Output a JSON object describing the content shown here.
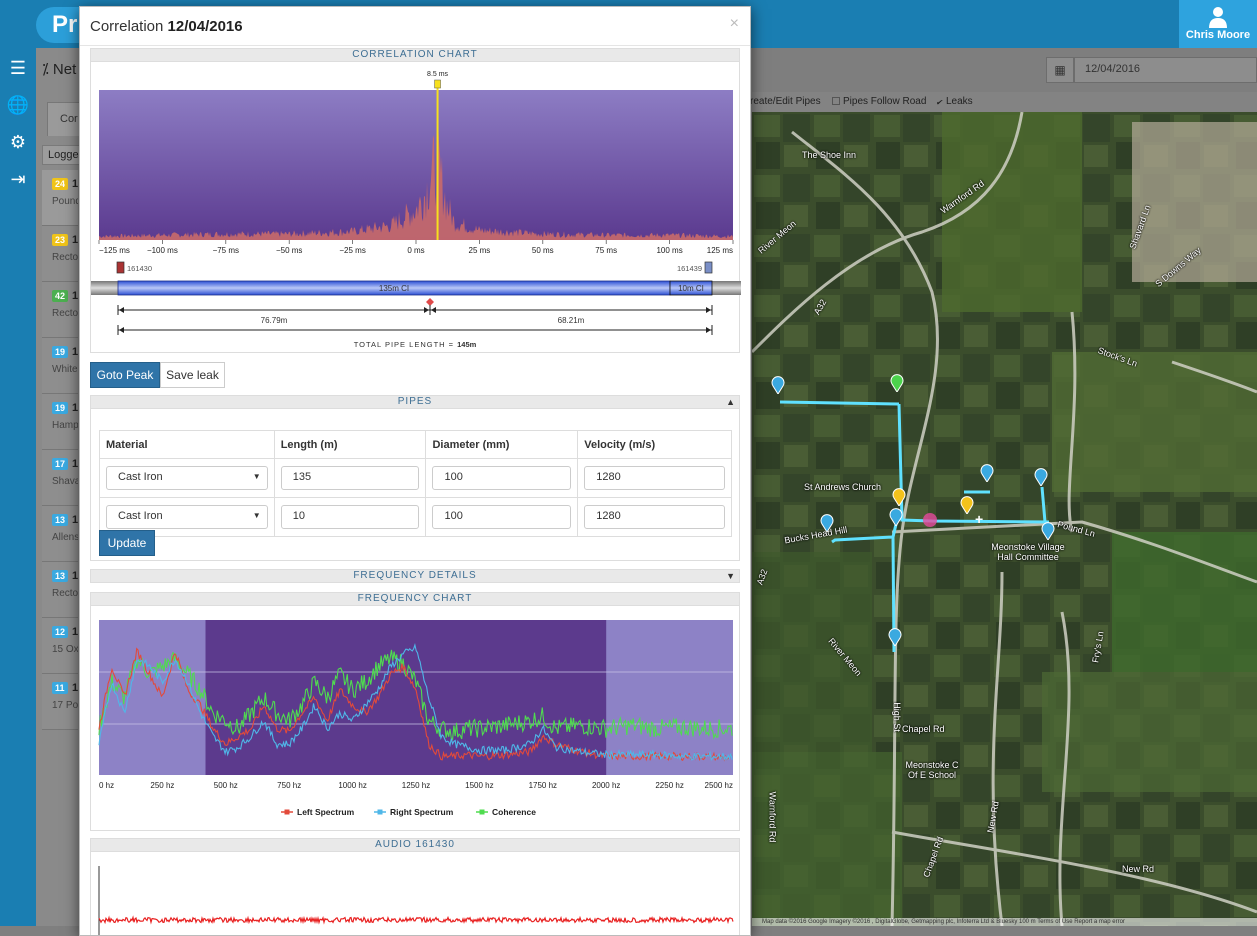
{
  "app": {
    "brand": "Pr",
    "user_name": "Chris Moore",
    "page_title": "Net",
    "tab_label": "Cor",
    "filter_label": "Logge",
    "date_value": "12/04/2016",
    "options": [
      {
        "label": "reate/Edit Pipes",
        "checked": null
      },
      {
        "label": "Pipes Follow Road",
        "checked": false
      },
      {
        "label": "Leaks",
        "checked": true
      }
    ],
    "loggers": [
      {
        "badge": "24",
        "color": "#f0c419",
        "id": "1",
        "addr": "Pound"
      },
      {
        "badge": "23",
        "color": "#f0c419",
        "id": "1",
        "addr": "Rector"
      },
      {
        "badge": "42",
        "color": "#4caf50",
        "id": "1",
        "addr": "Rector"
      },
      {
        "badge": "19",
        "color": "#3aa9e0",
        "id": "1",
        "addr": "White"
      },
      {
        "badge": "19",
        "color": "#3aa9e0",
        "id": "1",
        "addr": "Hamp"
      },
      {
        "badge": "17",
        "color": "#3aa9e0",
        "id": "1",
        "addr": "Shava"
      },
      {
        "badge": "13",
        "color": "#3aa9e0",
        "id": "1",
        "addr": "Allens"
      },
      {
        "badge": "13",
        "color": "#3aa9e0",
        "id": "1",
        "addr": "Rector"
      },
      {
        "badge": "12",
        "color": "#3aa9e0",
        "id": "1",
        "addr": "15 Ox"
      },
      {
        "badge": "11",
        "color": "#3aa9e0",
        "id": "1",
        "addr": "17 Po"
      }
    ],
    "map_labels": [
      "The Shoe Inn",
      "Warnford Rd",
      "River Meon",
      "A32",
      "Shavard Ln",
      "S Downs Way",
      "Stock's Ln",
      "St Andrews Church",
      "Pound Ln",
      "Meonstoke Village Hall Committee",
      "Bucks Head Hill",
      "River Meon",
      "Fry's Ln",
      "High St",
      "Chapel Rd",
      "Meonstoke C Of E School",
      "Chapel Rd",
      "New Rd",
      "New Rd",
      "Warnford Rd",
      "A32"
    ],
    "map_footer": "Map data ©2016 Google Imagery ©2016 , DigitalGlobe, Getmapping plc, Infoterra Ltd & Bluesky   100 m   Terms of Use   Report a map error"
  },
  "modal": {
    "title_prefix": "Correlation ",
    "title_date": "12/04/2016",
    "close": "×"
  },
  "correlation": {
    "section_title": "CORRELATION CHART",
    "peak_label": "8.5 ms",
    "x_ticks": [
      "−125 ms",
      "−100 ms",
      "−75 ms",
      "−50 ms",
      "−25 ms",
      "0 ms",
      "25 ms",
      "50 ms",
      "75 ms",
      "100 ms",
      "125 ms"
    ],
    "left_logger": "161430",
    "right_logger": "161439",
    "pipe_segment_1": "135m CI",
    "pipe_segment_2": "10m CI",
    "dist_left": "76.79m",
    "dist_right": "68.21m",
    "total_label": "TOTAL PIPE LENGTH = ",
    "total_value": "145m"
  },
  "chart_data": [
    {
      "type": "area",
      "title": "CORRELATION CHART",
      "x_unit": "ms",
      "xlim": [
        -125,
        125
      ],
      "x_ticks": [
        -125,
        -100,
        -75,
        -50,
        -25,
        0,
        25,
        50,
        75,
        100,
        125
      ],
      "peak_x": 8.5,
      "series": [
        {
          "color": "#c96a6a",
          "x": [
            -125,
            -100,
            -75,
            -50,
            -25,
            -10,
            0,
            4,
            6,
            8.5,
            10,
            12,
            15,
            25,
            50,
            75,
            100,
            125
          ],
          "values": [
            0.03,
            0.04,
            0.05,
            0.05,
            0.07,
            0.12,
            0.25,
            0.4,
            0.55,
            0.65,
            0.5,
            0.3,
            0.15,
            0.08,
            0.05,
            0.04,
            0.04,
            0.03
          ]
        }
      ]
    },
    {
      "type": "line",
      "title": "FREQUENCY CHART",
      "x_unit": "hz",
      "xlim": [
        0,
        2500
      ],
      "x_ticks": [
        0,
        250,
        500,
        750,
        1000,
        1250,
        1500,
        1750,
        2000,
        2250,
        2500
      ],
      "highlight_range": [
        420,
        2000
      ],
      "series": [
        {
          "name": "Left Spectrum",
          "color": "#e24a3b",
          "x": [
            0,
            50,
            100,
            150,
            200,
            250,
            300,
            350,
            400,
            450,
            500,
            550,
            600,
            650,
            700,
            750,
            800,
            850,
            900,
            950,
            1000,
            1050,
            1100,
            1150,
            1200,
            1250,
            1300,
            1350,
            1400,
            1450,
            1500,
            1600,
            1700,
            1750,
            1800,
            1900,
            2000,
            2100,
            2200,
            2300,
            2400,
            2500
          ],
          "values": [
            0.3,
            0.7,
            0.5,
            0.8,
            0.65,
            0.5,
            0.8,
            0.55,
            0.45,
            0.3,
            0.2,
            0.25,
            0.3,
            0.45,
            0.3,
            0.28,
            0.4,
            0.5,
            0.35,
            0.55,
            0.45,
            0.4,
            0.5,
            0.65,
            0.7,
            0.55,
            0.2,
            0.12,
            0.12,
            0.13,
            0.12,
            0.13,
            0.15,
            0.25,
            0.2,
            0.15,
            0.12,
            0.12,
            0.12,
            0.12,
            0.12,
            0.11
          ]
        },
        {
          "name": "Right Spectrum",
          "color": "#4fb7e8",
          "x": [
            0,
            50,
            100,
            150,
            200,
            250,
            300,
            350,
            400,
            450,
            500,
            550,
            600,
            650,
            700,
            750,
            800,
            850,
            900,
            950,
            1000,
            1050,
            1100,
            1150,
            1200,
            1250,
            1300,
            1350,
            1400,
            1450,
            1500,
            1600,
            1700,
            1750,
            1800,
            1900,
            2000,
            2100,
            2200,
            2300,
            2400,
            2500
          ],
          "values": [
            0.2,
            0.6,
            0.4,
            0.75,
            0.7,
            0.6,
            0.75,
            0.6,
            0.4,
            0.25,
            0.15,
            0.18,
            0.25,
            0.35,
            0.2,
            0.2,
            0.3,
            0.45,
            0.3,
            0.4,
            0.35,
            0.45,
            0.55,
            0.7,
            0.78,
            0.82,
            0.5,
            0.25,
            0.2,
            0.18,
            0.16,
            0.16,
            0.2,
            0.3,
            0.18,
            0.15,
            0.13,
            0.13,
            0.13,
            0.12,
            0.12,
            0.12
          ]
        },
        {
          "name": "Coherence",
          "color": "#4fdc4f",
          "x": [
            0,
            50,
            100,
            150,
            200,
            250,
            300,
            350,
            400,
            450,
            500,
            550,
            600,
            650,
            700,
            750,
            800,
            850,
            900,
            950,
            1000,
            1050,
            1100,
            1150,
            1200,
            1250,
            1300,
            1350,
            1400,
            1450,
            1500,
            1600,
            1700,
            1750,
            1800,
            1900,
            2000,
            2100,
            2200,
            2300,
            2400,
            2500
          ],
          "values": [
            0.3,
            0.6,
            0.5,
            0.75,
            0.65,
            0.7,
            0.75,
            0.65,
            0.55,
            0.4,
            0.35,
            0.3,
            0.4,
            0.5,
            0.4,
            0.35,
            0.45,
            0.6,
            0.5,
            0.65,
            0.55,
            0.6,
            0.7,
            0.75,
            0.72,
            0.6,
            0.35,
            0.3,
            0.28,
            0.3,
            0.3,
            0.32,
            0.35,
            0.38,
            0.3,
            0.32,
            0.3,
            0.32,
            0.3,
            0.31,
            0.3,
            0.3
          ]
        }
      ]
    }
  ],
  "actions": {
    "goto_peak": "Goto Peak",
    "save_leak": "Save leak",
    "update": "Update"
  },
  "pipes": {
    "section_title": "PIPES",
    "headers": [
      "Material",
      "Length (m)",
      "Diameter (mm)",
      "Velocity (m/s)"
    ],
    "rows": [
      {
        "material": "Cast Iron",
        "length": "135",
        "diameter": "100",
        "velocity": "1280"
      },
      {
        "material": "Cast Iron",
        "length": "10",
        "diameter": "100",
        "velocity": "1280"
      }
    ]
  },
  "frequency": {
    "details_title": "FREQUENCY DETAILS",
    "section_title": "FREQUENCY CHART",
    "x_ticks": [
      "0 hz",
      "250 hz",
      "500 hz",
      "750 hz",
      "1000 hz",
      "1250 hz",
      "1500 hz",
      "1750 hz",
      "2000 hz",
      "2250 hz",
      "2500 hz"
    ],
    "legend": [
      "Left Spectrum",
      "Right Spectrum",
      "Coherence"
    ]
  },
  "audio": {
    "section_title": "AUDIO 161430"
  },
  "colors": {
    "topbar": "#1a7eb2",
    "primary_button": "#2f74a8",
    "corr_bg_top": "#8d7dc4",
    "corr_bg_bottom": "#5b3a8f",
    "peak_line": "#f7e01d",
    "freq_bg": "#8d82c6",
    "freq_highlight": "#5c3a8d"
  }
}
